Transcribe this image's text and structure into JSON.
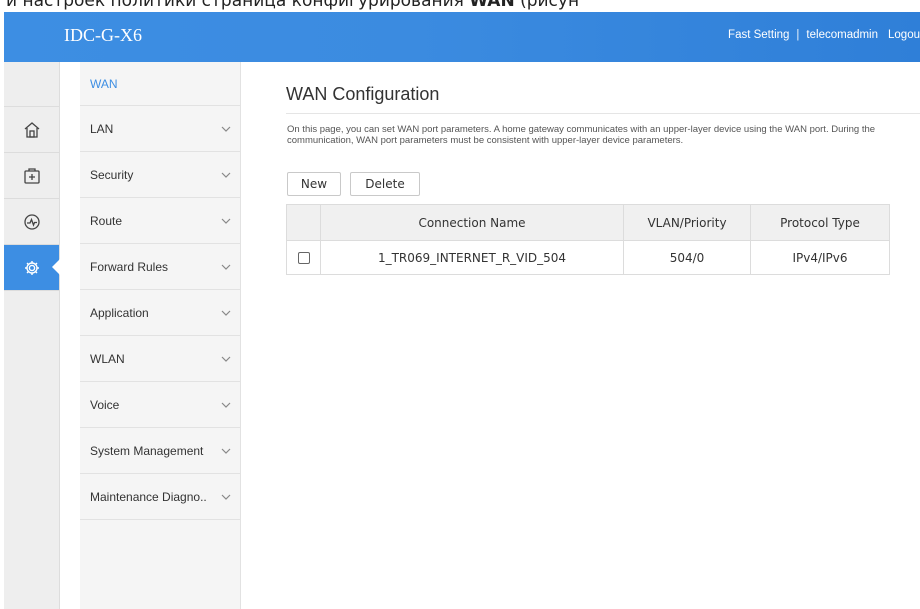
{
  "caption": {
    "text_part1": "и настроек политики страница конфигурирования ",
    "bold": "WAN",
    "text_part2": " (рисун"
  },
  "header": {
    "title": "IDC-G-X6",
    "fast_setting": "Fast Setting",
    "user": "telecomadmin",
    "logout": "Logou"
  },
  "iconbar": {
    "icons": [
      "home-icon",
      "add-box-icon",
      "diagnostics-icon",
      "gear-icon"
    ],
    "active_index": 3
  },
  "menu": {
    "items": [
      {
        "label": "WAN",
        "expandable": false
      },
      {
        "label": "LAN",
        "expandable": true
      },
      {
        "label": "Security",
        "expandable": true
      },
      {
        "label": "Route",
        "expandable": true
      },
      {
        "label": "Forward Rules",
        "expandable": true
      },
      {
        "label": "Application",
        "expandable": true
      },
      {
        "label": "WLAN",
        "expandable": true
      },
      {
        "label": "Voice",
        "expandable": true
      },
      {
        "label": "System Management",
        "expandable": true
      },
      {
        "label": "Maintenance Diagno..",
        "expandable": true
      }
    ]
  },
  "main": {
    "title": "WAN Configuration",
    "description": "On this page, you can set WAN port parameters. A home gateway communicates with an upper-layer device using the WAN port. During the communication, WAN port parameters must be consistent with upper-layer device parameters.",
    "new_label": "New",
    "delete_label": "Delete",
    "table": {
      "headers": [
        "",
        "Connection Name",
        "VLAN/Priority",
        "Protocol Type"
      ],
      "rows": [
        {
          "checked": false,
          "name": "1_TR069_INTERNET_R_VID_504",
          "vlan": "504/0",
          "protocol": "IPv4/IPv6"
        }
      ]
    }
  },
  "colors": {
    "accent": "#3d8ee3"
  }
}
